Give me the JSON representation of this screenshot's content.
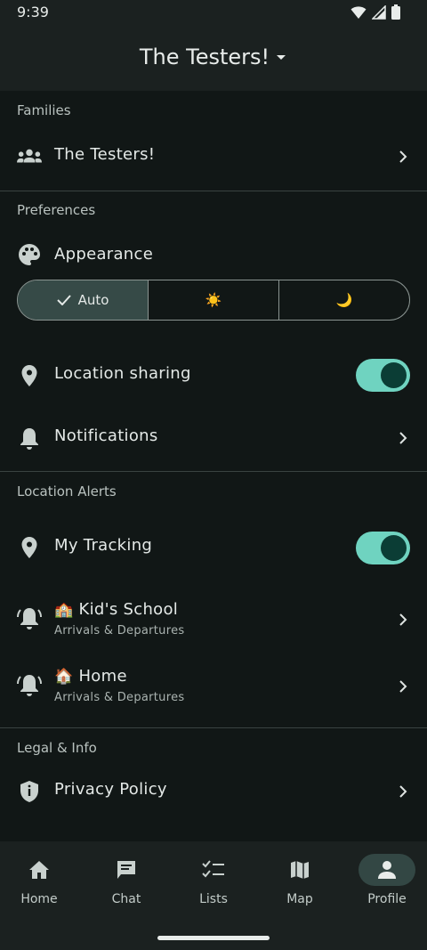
{
  "status": {
    "time": "9:39"
  },
  "header": {
    "title": "The Testers!"
  },
  "families": {
    "section_label": "Families",
    "item_label": "The Testers!"
  },
  "preferences": {
    "section_label": "Preferences",
    "appearance_label": "Appearance",
    "appearance_options": [
      "Auto",
      "☀️",
      "🌙"
    ],
    "selected_option": "Auto",
    "location_sharing_label": "Location sharing",
    "location_sharing_on": true,
    "notifications_label": "Notifications"
  },
  "location_alerts": {
    "section_label": "Location Alerts",
    "my_tracking_label": "My Tracking",
    "my_tracking_on": true,
    "places": [
      {
        "emoji": "🏫",
        "name": "Kid's School",
        "sub": "Arrivals & Departures"
      },
      {
        "emoji": "🏠",
        "name": "Home",
        "sub": "Arrivals & Departures"
      }
    ]
  },
  "legal": {
    "section_label": "Legal & Info",
    "privacy_label": "Privacy Policy"
  },
  "bottom_nav": {
    "items": [
      {
        "label": "Home",
        "icon": "home-icon"
      },
      {
        "label": "Chat",
        "icon": "chat-icon"
      },
      {
        "label": "Lists",
        "icon": "checklist-icon"
      },
      {
        "label": "Map",
        "icon": "map-icon"
      },
      {
        "label": "Profile",
        "icon": "person-icon"
      }
    ],
    "active": "Profile"
  },
  "colors": {
    "background": "#111716",
    "surface": "#1b2120",
    "accent": "#6fd3c0",
    "selected_segment": "#364a47"
  }
}
